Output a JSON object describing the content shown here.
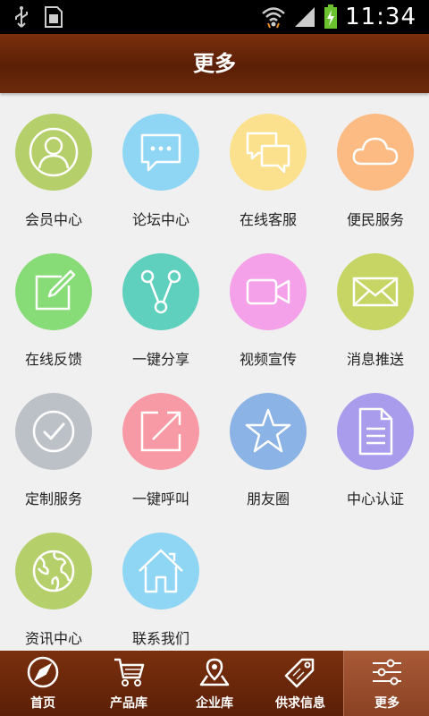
{
  "statusbar": {
    "time": "11:34",
    "icons": [
      "usb-icon",
      "sim-icon",
      "wifi-icon",
      "signal-icon",
      "battery-charging-icon"
    ]
  },
  "header": {
    "title": "更多"
  },
  "grid": {
    "items": [
      {
        "label": "会员中心",
        "icon": "user-icon",
        "color": "#b5cf6b"
      },
      {
        "label": "论坛中心",
        "icon": "chat-bubble-icon",
        "color": "#8fd6f5"
      },
      {
        "label": "在线客服",
        "icon": "dialog-icon",
        "color": "#fbe08e"
      },
      {
        "label": "便民服务",
        "icon": "cloud-icon",
        "color": "#fbbb83"
      },
      {
        "label": "在线反馈",
        "icon": "edit-icon",
        "color": "#88dc77"
      },
      {
        "label": "一键分享",
        "icon": "share-icon",
        "color": "#5ed0bd"
      },
      {
        "label": "视频宣传",
        "icon": "video-icon",
        "color": "#f5a1ea"
      },
      {
        "label": "消息推送",
        "icon": "mail-icon",
        "color": "#c6d564"
      },
      {
        "label": "定制服务",
        "icon": "check-icon",
        "color": "#bcc1c8"
      },
      {
        "label": "一键呼叫",
        "icon": "external-link-icon",
        "color": "#f79aa6"
      },
      {
        "label": "朋友圈",
        "icon": "star-icon",
        "color": "#8bb3e6"
      },
      {
        "label": "中心认证",
        "icon": "document-icon",
        "color": "#aa9cec"
      },
      {
        "label": "资讯中心",
        "icon": "globe-icon",
        "color": "#b5cf6b"
      },
      {
        "label": "联系我们",
        "icon": "home-icon",
        "color": "#8fd6f5"
      }
    ]
  },
  "bottomnav": {
    "tabs": [
      {
        "label": "首页",
        "icon": "compass-icon",
        "active": false
      },
      {
        "label": "产品库",
        "icon": "cart-icon",
        "active": false
      },
      {
        "label": "企业库",
        "icon": "map-icon",
        "active": false
      },
      {
        "label": "供求信息",
        "icon": "tag-icon",
        "active": false
      },
      {
        "label": "更多",
        "icon": "sliders-icon",
        "active": true
      }
    ]
  }
}
